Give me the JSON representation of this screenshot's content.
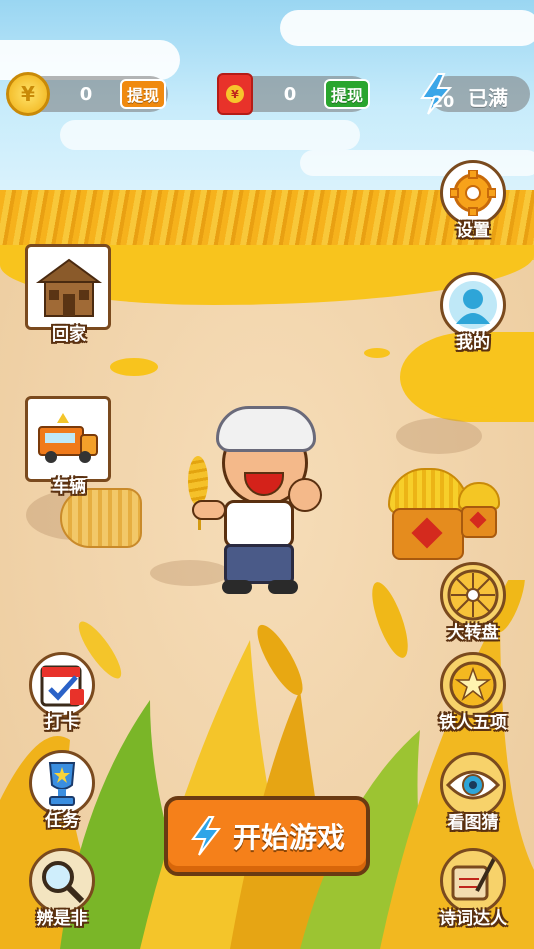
{
  "top_bar": {
    "coin_icon_glyph": "¥",
    "gold_coins": "0",
    "gold_withdraw_label": "提现",
    "red_packet_glyph": "¥",
    "red_packet_amount": "0",
    "red_packet_withdraw_label": "提现",
    "energy": "20",
    "energy_status": "已满"
  },
  "left_menu": {
    "home_label": "回家",
    "vehicle_label": "车辆",
    "checkin_label": "打卡",
    "task_label": "任务",
    "judge_label": "辨是非"
  },
  "right_menu": {
    "settings_label": "设置",
    "profile_label": "我的",
    "wheel_label": "大转盘",
    "ironman_label": "铁人五项",
    "picture_guess_label": "看图猜",
    "poetry_label": "诗词达人"
  },
  "start_button_label": "开始游戏",
  "colors": {
    "accent_orange": "#f5801a",
    "wheat_yellow": "#f8c41d",
    "withdraw_green": "#2aa52e",
    "red_packet": "#e8322a"
  }
}
